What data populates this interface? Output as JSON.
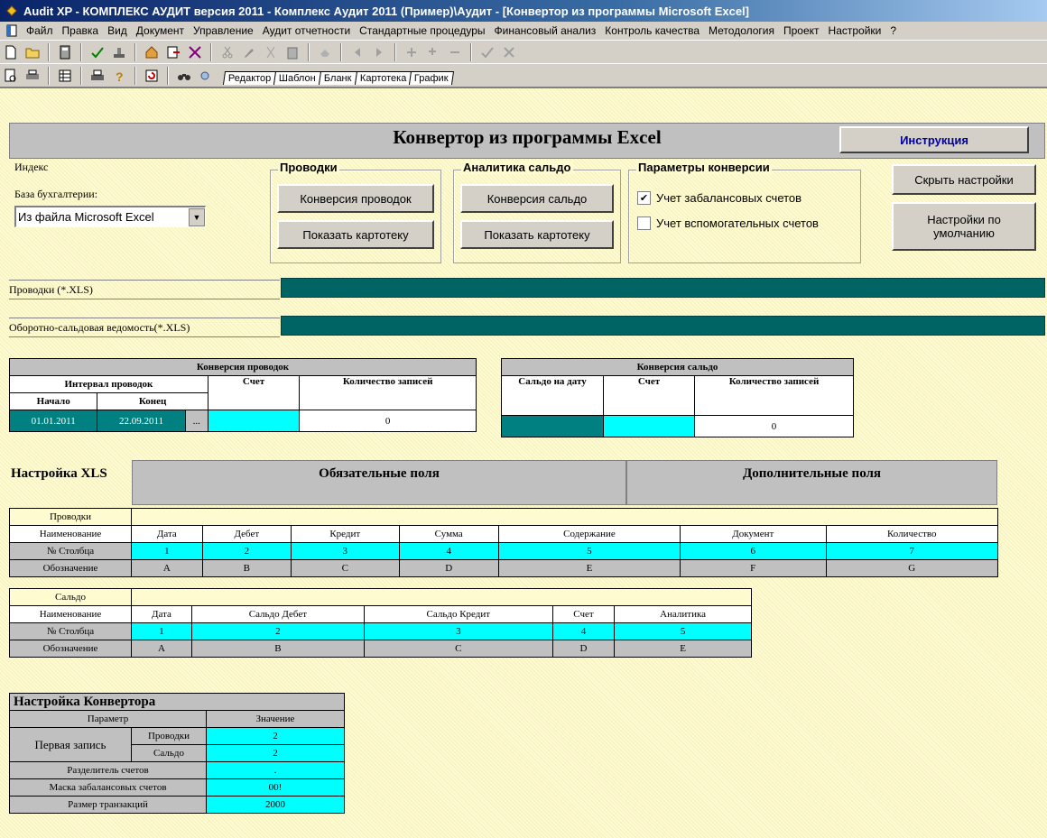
{
  "window": {
    "title": "Audit XP - КОМПЛЕКС АУДИТ версия 2011 - Комплекс Аудит 2011 (Пример)\\Аудит - [Конвертор из программы Microsoft Excel]"
  },
  "menu": [
    "Файл",
    "Правка",
    "Вид",
    "Документ",
    "Управление",
    "Аудит отчетности",
    "Стандартные процедуры",
    "Финансовый анализ",
    "Контроль качества",
    "Методология",
    "Проект",
    "Настройки",
    "?"
  ],
  "tabs": [
    "Редактор",
    "Шаблон",
    "Бланк",
    "Картотека",
    "График"
  ],
  "header": {
    "title": "Конвертор из программы Excel",
    "instruction": "Инструкция"
  },
  "left": {
    "index_label": "Индекс",
    "base_label": "База бухгалтерии:",
    "base_value": "Из файла Microsoft Excel"
  },
  "provodki_group": {
    "title": "Проводки",
    "convert": "Конверсия проводок",
    "show": "Показать картотеку"
  },
  "saldo_group": {
    "title": "Аналитика сальдо",
    "convert": "Конверсия сальдо",
    "show": "Показать картотеку"
  },
  "params_group": {
    "title": "Параметры конверсии",
    "offbalance": {
      "label": "Учет забалансовых счетов",
      "checked": true
    },
    "auxiliary": {
      "label": "Учет вспомогательных счетов",
      "checked": false
    }
  },
  "right_buttons": {
    "hide": "Скрыть настройки",
    "defaults": "Настройки по умолчанию"
  },
  "files": {
    "provodki_label": "Проводки (*.XLS)",
    "osv_label": "Оборотно-сальдовая ведомость(*.XLS)"
  },
  "conv_provodki": {
    "title": "Конверсия проводок",
    "interval": "Интервал проводок",
    "account": "Счет",
    "count_h": "Количество записей",
    "start_h": "Начало",
    "end_h": "Конец",
    "start": "01.01.2011",
    "end": "22.09.2011",
    "dots": "...",
    "count": "0"
  },
  "conv_saldo": {
    "title": "Конверсия сальдо",
    "date_h": "Сальдо на дату",
    "account": "Счет",
    "count_h": "Количество записей",
    "count": "0"
  },
  "xls": {
    "title": "Настройка XLS",
    "required": "Обязательные поля",
    "extra": "Дополнительные поля",
    "provodki": "Проводки",
    "saldo": "Сальдо",
    "name": "Наименование",
    "col": "№ Столбца",
    "sym": "Обозначение",
    "p_names": [
      "Дата",
      "Дебет",
      "Кредит",
      "Сумма",
      "Содержание",
      "Документ",
      "Количество"
    ],
    "p_cols": [
      "1",
      "2",
      "3",
      "4",
      "5",
      "6",
      "7"
    ],
    "p_syms": [
      "A",
      "B",
      "C",
      "D",
      "E",
      "F",
      "G"
    ],
    "s_names": [
      "Дата",
      "Сальдо Дебет",
      "Сальдо Кредит",
      "Счет",
      "Аналитика"
    ],
    "s_cols": [
      "1",
      "2",
      "3",
      "4",
      "5"
    ],
    "s_syms": [
      "A",
      "B",
      "C",
      "D",
      "E"
    ]
  },
  "conv_settings": {
    "title": "Настройка Конвертора",
    "param": "Параметр",
    "value": "Значение",
    "first": "Первая запись",
    "first_p": "Проводки",
    "first_p_v": "2",
    "first_s": "Сальдо",
    "first_s_v": "2",
    "sep": "Разделитель счетов",
    "sep_v": ".",
    "mask": "Маска забалансовых счетов",
    "mask_v": "00!",
    "tx": "Размер транзакций",
    "tx_v": "2000"
  },
  "colors": {
    "teal": "#006464",
    "cyan": "#00ffff",
    "gray": "#c0c0c0",
    "instruction": "#0000a0"
  }
}
